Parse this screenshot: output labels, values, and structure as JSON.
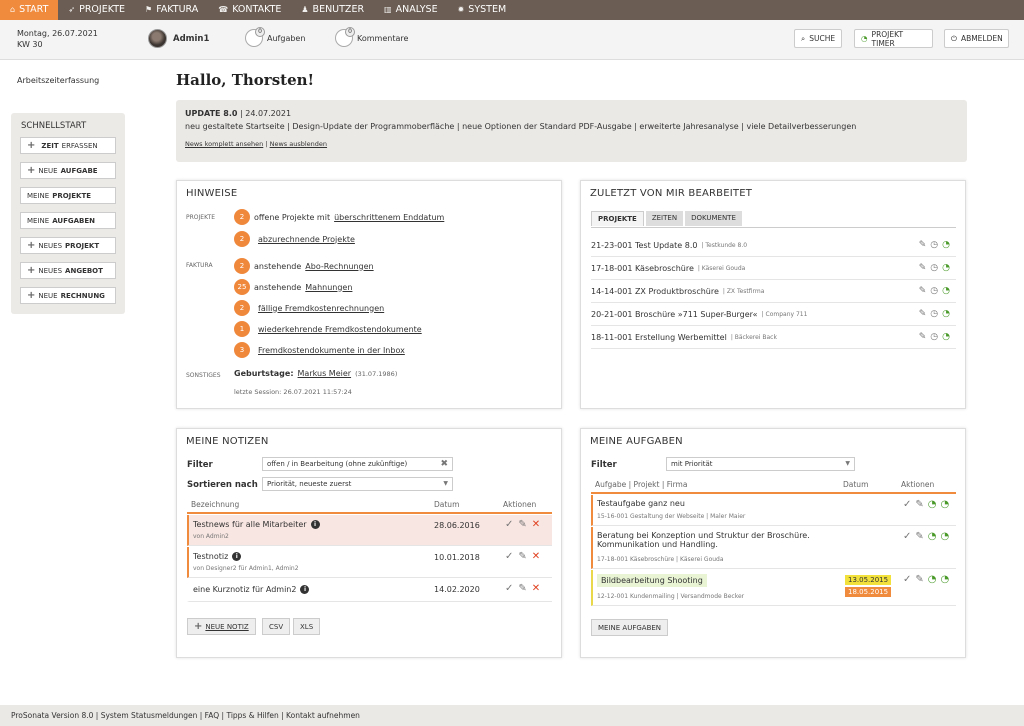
{
  "nav": [
    "START",
    "PROJEKTE",
    "FAKTURA",
    "KONTAKTE",
    "BENUTZER",
    "ANALYSE",
    "SYSTEM"
  ],
  "header": {
    "date": "Montag, 26.07.2021",
    "week": "KW 30",
    "user": "Admin1",
    "tasks_label": "Aufgaben",
    "tasks_count": "0",
    "comments_label": "Kommentare",
    "comments_count": "0",
    "search": "SUCHE",
    "timer": "PROJEKT TIMER",
    "logout": "ABMELDEN"
  },
  "sidebar": {
    "link": "Arbeitszeiterfassung",
    "title": "SCHNELLSTART",
    "buttons": [
      {
        "a": "",
        "b": "ZEIT",
        "c": " ERFASSEN",
        "plus": true
      },
      {
        "a": "NEUE ",
        "b": "AUFGABE",
        "c": "",
        "plus": true
      },
      {
        "a": "MEINE ",
        "b": "PROJEKTE",
        "c": "",
        "plus": false
      },
      {
        "a": "MEINE ",
        "b": "AUFGABEN",
        "c": "",
        "plus": false
      },
      {
        "a": "NEUES ",
        "b": "PROJEKT",
        "c": "",
        "plus": true
      },
      {
        "a": "NEUES ",
        "b": "ANGEBOT",
        "c": "",
        "plus": true
      },
      {
        "a": "NEUE ",
        "b": "RECHNUNG",
        "c": "",
        "plus": true
      }
    ]
  },
  "greeting": "Hallo, Thorsten!",
  "update": {
    "title": "UPDATE 8.0",
    "date": " | 24.07.2021",
    "text": "neu gestaltete Startseite | Design-Update der Programmoberfläche | neue Optionen der Standard PDF-Ausgabe | erweiterte Jahresanalyse | viele Detailverbesserungen",
    "link1": "News komplett ansehen",
    "sep": " | ",
    "link2": "News ausblenden"
  },
  "hinweise": {
    "title": "HINWEISE",
    "projekte": "PROJEKTE",
    "faktura": "FAKTURA",
    "sonstiges": "SONSTIGES",
    "items": [
      {
        "n": "2",
        "pre": "offene Projekte mit ",
        "link": "überschrittenem Enddatum"
      },
      {
        "n": "2",
        "pre": "",
        "link": "abzurechnende Projekte"
      },
      {
        "n": "2",
        "pre": "anstehende ",
        "link": "Abo-Rechnungen"
      },
      {
        "n": "25",
        "pre": "anstehende ",
        "link": "Mahnungen"
      },
      {
        "n": "2",
        "pre": "",
        "link": "fällige Fremdkostenrechnungen"
      },
      {
        "n": "1",
        "pre": "",
        "link": "wiederkehrende Fremdkostendokumente"
      },
      {
        "n": "3",
        "pre": "",
        "link": "Fremdkostendokumente in der Inbox"
      }
    ],
    "birthday_label": "Geburtstage:",
    "birthday_name": "Markus Meier",
    "birthday_date": "(31.07.1986)",
    "session": "letzte Session: 26.07.2021 11:57:24"
  },
  "zuletzt": {
    "title": "ZULETZT VON MIR BEARBEITET",
    "tabs": [
      "PROJEKTE",
      "ZEITEN",
      "DOKUMENTE"
    ],
    "rows": [
      {
        "t": "21-23-001 Test Update 8.0",
        "s": "| Testkunde 8.0"
      },
      {
        "t": "17-18-001 Käsebroschüre",
        "s": "| Käserei Gouda"
      },
      {
        "t": "14-14-001 ZX Produktbroschüre",
        "s": "| ZX Testfirma"
      },
      {
        "t": "20-21-001 Broschüre »711 Super-Burger«",
        "s": "| Company 711"
      },
      {
        "t": "18-11-001 Erstellung Werbemittel",
        "s": "| Bäckerei Back"
      }
    ]
  },
  "notizen": {
    "title": "MEINE NOTIZEN",
    "filter_label": "Filter",
    "filter_value": "offen / in Bearbeitung (ohne zukünftige)",
    "sort_label": "Sortieren nach",
    "sort_value": "Priorität, neueste zuerst",
    "cols": [
      "Bezeichnung",
      "Datum",
      "Aktionen"
    ],
    "rows": [
      {
        "t": "Testnews für alle Mitarbeiter",
        "s": "von Admin2",
        "d": "28.06.2016"
      },
      {
        "t": "Testnotiz",
        "s": "von Designer2 für Admin1, Admin2",
        "d": "10.01.2018"
      },
      {
        "t": "eine Kurznotiz für Admin2",
        "s": "",
        "d": "14.02.2020"
      }
    ],
    "btn_new": "NEUE NOTIZ",
    "btn_csv": "CSV",
    "btn_xls": "XLS"
  },
  "aufgaben": {
    "title": "MEINE AUFGABEN",
    "filter_label": "Filter",
    "filter_value": "mit Priorität",
    "cols": [
      "Aufgabe | Projekt | Firma",
      "Datum",
      "Aktionen"
    ],
    "rows": [
      {
        "t": "Testaufgabe ganz neu",
        "s": "15-16-001 Gestaltung der Webseite | Maler Maier"
      },
      {
        "t": "Beratung bei Konzeption und Struktur der Broschüre. Kommunikation und Handling.",
        "s": "17-18-001 Käsebroschüre | Käserei Gouda"
      },
      {
        "t": "Bildbearbeitung Shooting",
        "s": "12-12-001 Kundenmailing | Versandmode Becker",
        "d1": "13.05.2015",
        "d2": "18.05.2015"
      }
    ],
    "btn": "MEINE AUFGABEN"
  },
  "footer": "ProSonata Version 8.0   |   System Statusmeldungen   |   FAQ   |   Tipps & Hilfen   |   Kontakt aufnehmen",
  "colors": {
    "accent": "#f08a3c",
    "nav": "#6b5d53"
  }
}
